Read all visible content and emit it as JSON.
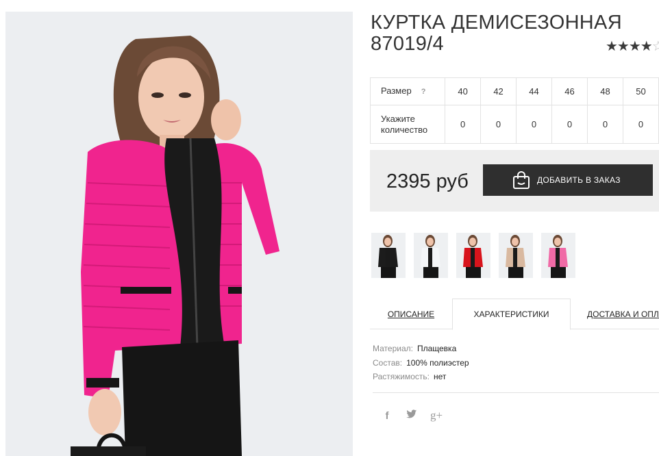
{
  "product": {
    "title": "КУРТКА ДЕМИСЕЗОННАЯ 87019/4",
    "rating": {
      "filled_stars": "★★★★",
      "empty_stars": "☆",
      "value": 4,
      "max": 5
    },
    "main_photo_alt": "pink quilted jacket"
  },
  "sizes": {
    "size_label": "Размер",
    "help_glyph": "?",
    "qty_label": "Укажите количество",
    "columns": [
      "40",
      "42",
      "44",
      "46",
      "48",
      "50"
    ],
    "quantities": [
      "0",
      "0",
      "0",
      "0",
      "0",
      "0"
    ]
  },
  "purchase": {
    "price": "2395 руб",
    "add_button_label": "ДОБАВИТЬ В ЗАКАЗ"
  },
  "thumbnails": [
    {
      "color": "#1c1c1c",
      "name": "thumb-black-jacket"
    },
    {
      "color": "#f4f6f8",
      "name": "thumb-white-jacket"
    },
    {
      "color": "#d8141c",
      "name": "thumb-red-jacket"
    },
    {
      "color": "#d9b9a0",
      "name": "thumb-beige-jacket"
    },
    {
      "color": "#f06aa6",
      "name": "thumb-pink-jacket"
    }
  ],
  "tabs": [
    {
      "label": "ОПИСАНИЕ",
      "active": false
    },
    {
      "label": "ХАРАКТЕРИСТИКИ",
      "active": true
    },
    {
      "label": "ДОСТАВКА И ОПЛАТА",
      "active": false
    }
  ],
  "specs": [
    {
      "key": "Материал:",
      "value": "Плащевка"
    },
    {
      "key": "Состав:",
      "value": "100% полиэстер"
    },
    {
      "key": "Растяжимость:",
      "value": "нет"
    }
  ],
  "social": {
    "facebook_glyph": "f",
    "twitter_glyph": "🐦",
    "googleplus_glyph": "g+"
  },
  "colors": {
    "jacket_pink": "#f0248e",
    "button_bg": "#2f2f2f",
    "buy_box_bg": "#eeeeee"
  }
}
